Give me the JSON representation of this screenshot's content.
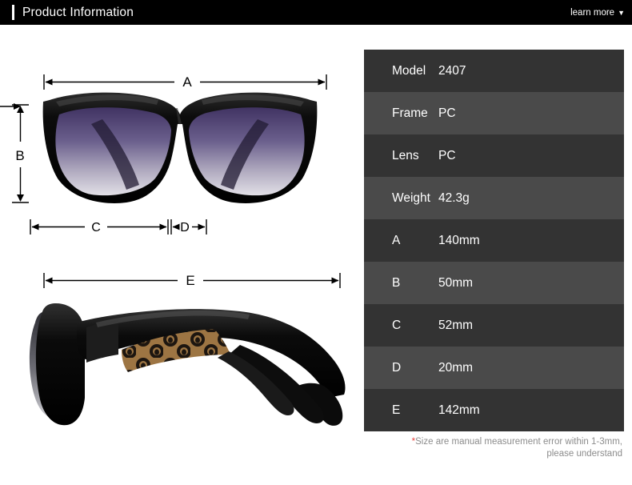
{
  "header": {
    "title": "Product Information",
    "learn_more_label": "learn more",
    "caret_icon": "chevron-down-icon",
    "caret_glyph": "▼",
    "background_color": "#000000",
    "text_color": "#ffffff"
  },
  "diagram": {
    "front_view": {
      "alt": "sunglasses-front-view",
      "dimension_labels": {
        "a": "A",
        "b": "B",
        "c": "C",
        "d": "D"
      }
    },
    "side_view": {
      "alt": "sunglasses-side-view",
      "dimension_labels": {
        "e": "E"
      }
    },
    "colors": {
      "frame": "#0d0d0d",
      "lens_top": "#46386b",
      "lens_bottom": "#d9d7e1",
      "pattern_base": "#c9934f",
      "pattern_spot": "#2a211a",
      "line": "#000000"
    }
  },
  "spec_table": {
    "rows": [
      {
        "label": "Model",
        "value": "2407"
      },
      {
        "label": "Frame",
        "value": "PC"
      },
      {
        "label": "Lens",
        "value": "PC"
      },
      {
        "label": "Weight",
        "value": "42.3g"
      },
      {
        "label": "A",
        "value": "140mm"
      },
      {
        "label": "B",
        "value": "50mm"
      },
      {
        "label": "C",
        "value": "52mm"
      },
      {
        "label": "D",
        "value": "20mm"
      },
      {
        "label": "E",
        "value": "142mm"
      }
    ],
    "row_color_odd": "#333333",
    "row_color_even": "#4a4a4a",
    "text_color": "#ffffff"
  },
  "note": {
    "star": "*",
    "line1": "Size are manual measurement error within 1-3mm,",
    "line2": "please understand",
    "star_color": "#e8403a",
    "text_color": "#8c8c8c"
  }
}
